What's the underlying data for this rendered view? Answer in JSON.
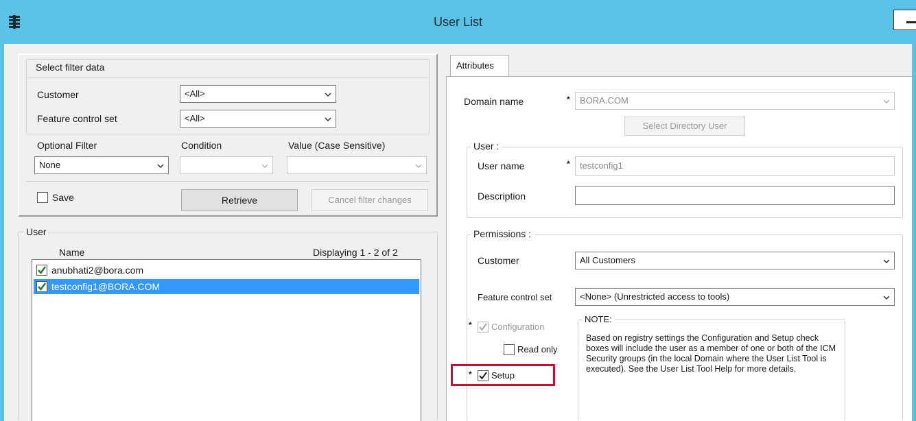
{
  "window": {
    "title": "User List"
  },
  "filter": {
    "group_label": "Select filter data",
    "customer_label": "Customer",
    "customer_value": "<All>",
    "fcs_label": "Feature control set",
    "fcs_value": "<All>",
    "optional_filter_label": "Optional Filter",
    "optional_filter_value": "None",
    "condition_label": "Condition",
    "condition_value": "",
    "value_label": "Value (Case Sensitive)",
    "value_value": "",
    "save_label": "Save",
    "retrieve_label": "Retrieve",
    "cancel_label": "Cancel filter changes"
  },
  "user_list": {
    "group_label": "User",
    "name_header": "Name",
    "count_text": "Displaying 1 - 2 of 2",
    "items": [
      {
        "name": "anubhati2@bora.com",
        "checked": true,
        "selected": false
      },
      {
        "name": "testconfig1@BORA.COM",
        "checked": true,
        "selected": true
      }
    ]
  },
  "attributes": {
    "tab_label": "Attributes",
    "domain_label": "Domain name",
    "domain_value": "BORA.COM",
    "select_dir_user_label": "Select Directory User",
    "user_group_label": "User :",
    "user_name_label": "User name",
    "user_name_value": "testconfig1",
    "description_label": "Description",
    "description_value": "",
    "permissions_label": "Permissions :",
    "perm_customer_label": "Customer",
    "perm_customer_value": "All Customers",
    "perm_fcs_label": "Feature control set",
    "perm_fcs_value": "<None> (Unrestricted access to tools)",
    "configuration_label": "Configuration",
    "read_only_label": "Read only",
    "setup_label": "Setup",
    "required_marker": "*",
    "note_label": "NOTE:",
    "note_text": "Based on registry settings the Configuration and Setup check boxes will include the user as a member of one or both of the ICM Security groups (in the local Domain where the User List Tool is executed). See the User List Tool Help for more details."
  },
  "colors": {
    "titlebar": "#5bc2e7",
    "selection": "#3399ff",
    "highlight_box": "#c8102e",
    "checkmark": "#1f7a1f"
  }
}
